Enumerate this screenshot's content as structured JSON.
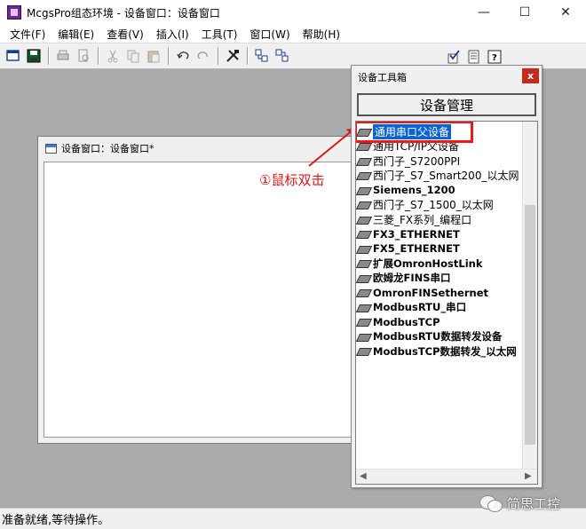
{
  "app": {
    "title": "McgsPro组态环境 - 设备窗口：设备窗口",
    "controls": {
      "minimize": "—",
      "maximize": "☐",
      "close": "✕"
    }
  },
  "menu": [
    {
      "label": "文件(F)"
    },
    {
      "label": "编辑(E)"
    },
    {
      "label": "查看(V)"
    },
    {
      "label": "插入(I)"
    },
    {
      "label": "工具(T)"
    },
    {
      "label": "窗口(W)"
    },
    {
      "label": "帮助(H)"
    }
  ],
  "toolbar": {
    "icons": [
      "new-window-icon",
      "save-icon",
      "print-icon",
      "print-preview-icon",
      "cut-icon",
      "copy-icon",
      "paste-icon",
      "undo-icon",
      "redo-icon",
      "tools-icon",
      "device-left-icon",
      "device-right-icon",
      "check-icon",
      "list-icon",
      "help-icon"
    ]
  },
  "child_window": {
    "title": "设备窗口：设备窗口*"
  },
  "toolbox": {
    "title": "设备工具箱",
    "close_label": "x",
    "manage_button": "设备管理",
    "items": [
      {
        "label": "通用串口父设备",
        "selected": true,
        "bold": false
      },
      {
        "label": "通用TCP/IP父设备",
        "selected": false,
        "bold": false
      },
      {
        "label": "西门子_S7200PPI",
        "selected": false,
        "bold": false
      },
      {
        "label": "西门子_S7_Smart200_以太网",
        "selected": false,
        "bold": false
      },
      {
        "label": "Siemens_1200",
        "selected": false,
        "bold": true
      },
      {
        "label": "西门子_S7_1500_以太网",
        "selected": false,
        "bold": false
      },
      {
        "label": "三菱_FX系列_编程口",
        "selected": false,
        "bold": false
      },
      {
        "label": "FX3_ETHERNET",
        "selected": false,
        "bold": true
      },
      {
        "label": "FX5_ETHERNET",
        "selected": false,
        "bold": true
      },
      {
        "label": "扩展OmronHostLink",
        "selected": false,
        "bold": true
      },
      {
        "label": "欧姆龙FINS串口",
        "selected": false,
        "bold": true
      },
      {
        "label": "OmronFINSethernet",
        "selected": false,
        "bold": true
      },
      {
        "label": "ModbusRTU_串口",
        "selected": false,
        "bold": true
      },
      {
        "label": "ModbusTCP",
        "selected": false,
        "bold": true
      },
      {
        "label": "ModbusRTU数据转发设备",
        "selected": false,
        "bold": true
      },
      {
        "label": "ModbusTCP数据转发_以太网",
        "selected": false,
        "bold": true
      }
    ]
  },
  "annotation": {
    "text": "①鼠标双击",
    "color": "#e81414"
  },
  "status": {
    "text": "准备就绪,等待操作。"
  },
  "watermark": {
    "text": "简思工控"
  },
  "colors": {
    "workspace": "#ababab",
    "selection": "#0a64d6",
    "highlight_box": "#f01818",
    "close_button": "#c42b1c"
  }
}
